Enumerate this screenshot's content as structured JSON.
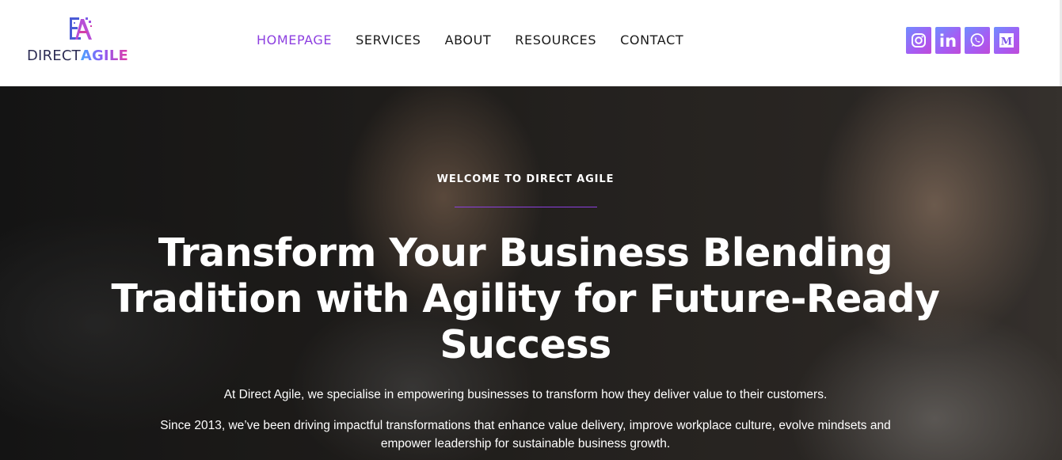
{
  "logo": {
    "mark_letters": "EA",
    "word1": "DIRECT",
    "word2": "AGILE"
  },
  "nav": {
    "items": [
      {
        "label": "HOMEPAGE",
        "active": true
      },
      {
        "label": "SERVICES",
        "active": false
      },
      {
        "label": "ABOUT",
        "active": false
      },
      {
        "label": "RESOURCES",
        "active": false
      },
      {
        "label": "CONTACT",
        "active": false
      }
    ]
  },
  "social": {
    "icons": [
      "instagram-icon",
      "linkedin-icon",
      "whatsapp-icon",
      "medium-icon"
    ],
    "linkedin_text": "in",
    "medium_text": "M"
  },
  "hero": {
    "eyebrow": "WELCOME TO DIRECT AGILE",
    "headline": "Transform Your Business Blending Tradition with Agility for Future-Ready Success",
    "paragraph1": "At Direct Agile, we specialise in empowering businesses to transform how they deliver value to their customers.",
    "paragraph2": "Since 2013, we’ve been driving impactful transformations that enhance value delivery, improve workplace culture, evolve mindsets and empower leadership for sustainable business growth."
  },
  "colors": {
    "accent": "#8d3fe0",
    "social_gradient_start": "#6f8dff",
    "social_gradient_end": "#c04ad8",
    "header_bg": "#ffffff",
    "hero_text": "#ffffff"
  }
}
